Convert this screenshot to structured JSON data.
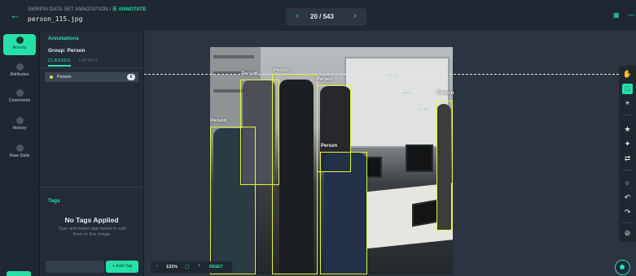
{
  "header": {
    "breadcrumb_prefix": "SKRIPSI DATA SET ANNOTATION /",
    "breadcrumb_current": "ANNOTATE",
    "filename": "person_115.jpg",
    "pager": {
      "counter": "20 / 543",
      "prev_icon": "chevron-left-icon",
      "next_icon": "chevron-right-icon"
    }
  },
  "rail": {
    "items": [
      {
        "label": "Annots",
        "icon": "annotations-icon",
        "active": true
      },
      {
        "label": "Attributes",
        "icon": "attributes-icon"
      },
      {
        "label": "Comments",
        "icon": "comments-icon"
      },
      {
        "label": "History",
        "icon": "history-icon"
      },
      {
        "label": "Raw Data",
        "icon": "raw-data-icon"
      }
    ]
  },
  "panel": {
    "title": "Annotations",
    "group": "Group: Person",
    "tabs": [
      "CLASSES",
      "LAYERS"
    ],
    "classes": [
      {
        "label": "Person",
        "count": "6",
        "color": "#d6e83a"
      }
    ],
    "tags": {
      "title": "Tags",
      "empty_title": "No Tags Applied",
      "empty_desc": "Type and select tags below to add them to this image.",
      "add_button": "+ Add Tag"
    }
  },
  "canvas": {
    "annotations": [
      {
        "label": "Person"
      },
      {
        "label": "Person"
      },
      {
        "label": "Person"
      },
      {
        "label": "Person"
      },
      {
        "label": "Person"
      },
      {
        "label": "Person"
      }
    ],
    "zoom": {
      "value": "131%",
      "reset": "RESET"
    }
  },
  "colors": {
    "accent": "#27e0a8",
    "box": "#e6f23a",
    "bg": "#2b3440"
  }
}
